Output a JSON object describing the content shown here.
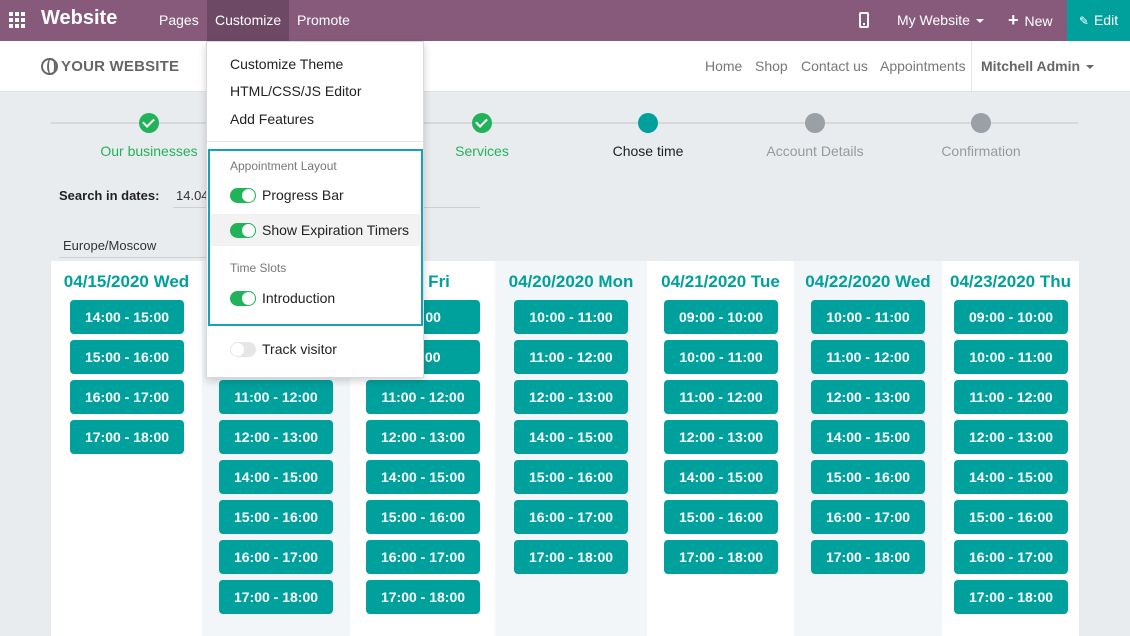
{
  "topbar": {
    "brand": "Website",
    "menus": [
      "Pages",
      "Customize",
      "Promote"
    ],
    "site_selector": "My Website",
    "new_label": "New",
    "edit_label": "Edit"
  },
  "header": {
    "logo": "YOUR WEBSITE",
    "nav": [
      "Home",
      "Shop",
      "Contact us",
      "Appointments"
    ],
    "user": "Mitchell Admin"
  },
  "progress": {
    "steps": [
      {
        "label": "Our businesses",
        "state": "done"
      },
      {
        "label": "",
        "state": "done"
      },
      {
        "label": "Services",
        "state": "done"
      },
      {
        "label": "Chose time",
        "state": "current"
      },
      {
        "label": "Account Details",
        "state": "todo"
      },
      {
        "label": "Confirmation",
        "state": "todo"
      }
    ]
  },
  "search": {
    "label": "Search in dates:",
    "value": "14.04"
  },
  "timezone": "Europe/Moscow",
  "days": [
    {
      "title": "04/15/2020 Wed",
      "slots": [
        "14:00 - 15:00",
        "15:00 - 16:00",
        "16:00 - 17:00",
        "17:00 - 18:00"
      ]
    },
    {
      "title": "",
      "slots": [
        "",
        "",
        "11:00 - 12:00",
        "12:00 - 13:00",
        "14:00 - 15:00",
        "15:00 - 16:00",
        "16:00 - 17:00",
        "17:00 - 18:00"
      ]
    },
    {
      "title": "020 Fri",
      "slots": [
        "10:00",
        "11:00",
        "11:00 - 12:00",
        "12:00 - 13:00",
        "14:00 - 15:00",
        "15:00 - 16:00",
        "16:00 - 17:00",
        "17:00 - 18:00"
      ]
    },
    {
      "title": "04/20/2020 Mon",
      "slots": [
        "10:00 - 11:00",
        "11:00 - 12:00",
        "12:00 - 13:00",
        "14:00 - 15:00",
        "15:00 - 16:00",
        "16:00 - 17:00",
        "17:00 - 18:00"
      ]
    },
    {
      "title": "04/21/2020 Tue",
      "slots": [
        "09:00 - 10:00",
        "10:00 - 11:00",
        "11:00 - 12:00",
        "12:00 - 13:00",
        "14:00 - 15:00",
        "15:00 - 16:00",
        "17:00 - 18:00"
      ]
    },
    {
      "title": "04/22/2020 Wed",
      "slots": [
        "10:00 - 11:00",
        "11:00 - 12:00",
        "12:00 - 13:00",
        "14:00 - 15:00",
        "15:00 - 16:00",
        "16:00 - 17:00",
        "17:00 - 18:00"
      ]
    },
    {
      "title": "04/23/2020 Thu",
      "slots": [
        "09:00 - 10:00",
        "10:00 - 11:00",
        "11:00 - 12:00",
        "12:00 - 13:00",
        "14:00 - 15:00",
        "15:00 - 16:00",
        "16:00 - 17:00",
        "17:00 - 18:00"
      ]
    }
  ],
  "dropdown": {
    "items": [
      "Customize Theme",
      "HTML/CSS/JS Editor",
      "Add Features"
    ],
    "layout_header": "Appointment Layout",
    "layout_options": [
      {
        "label": "Progress Bar",
        "on": true
      },
      {
        "label": "Show Expiration Timers",
        "on": true
      }
    ],
    "slots_header": "Time Slots",
    "slot_options": [
      {
        "label": "Introduction",
        "on": true
      }
    ],
    "track_option": {
      "label": "Track visitor",
      "on": false
    }
  },
  "colors": {
    "brand_purple": "#875a7b",
    "accent_teal": "#00a09d",
    "success_green": "#21b35a"
  }
}
